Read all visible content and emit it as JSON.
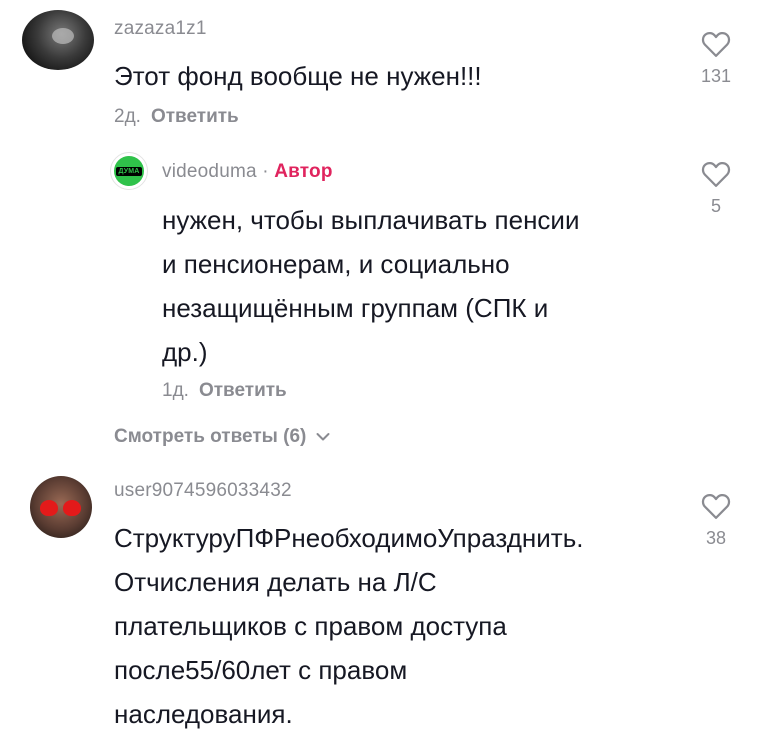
{
  "comments": [
    {
      "username": "zazaza1z1",
      "text": "Этот фонд вообще не нужен!!!",
      "age": "2д.",
      "reply_label": "Ответить",
      "likes": "131"
    },
    {
      "username": "videoduma",
      "separator": " · ",
      "badge": "Автор",
      "avatar_text": "ДУМА",
      "text_lines": [
        "нужен, чтобы выплачивать пенсии",
        "и пенсионерам, и социально",
        "незащищённым группам (СПК и",
        "др.)"
      ],
      "age": "1д.",
      "reply_label": "Ответить",
      "likes": "5"
    },
    {
      "username": "user9074596033432",
      "text_lines": [
        "СтруктуруПФРнеобходимоУпразднить.",
        "Отчисления делать на Л/С",
        "плательщиков с правом доступа",
        "после55/60лет с правом",
        "наследования."
      ],
      "likes": "38"
    }
  ],
  "view_replies": {
    "label": "Смотреть ответы (6)"
  },
  "colors": {
    "text": "#161823",
    "muted": "#8a8b91",
    "author_badge": "#e0245e",
    "avatar_green": "#2fc24a"
  }
}
